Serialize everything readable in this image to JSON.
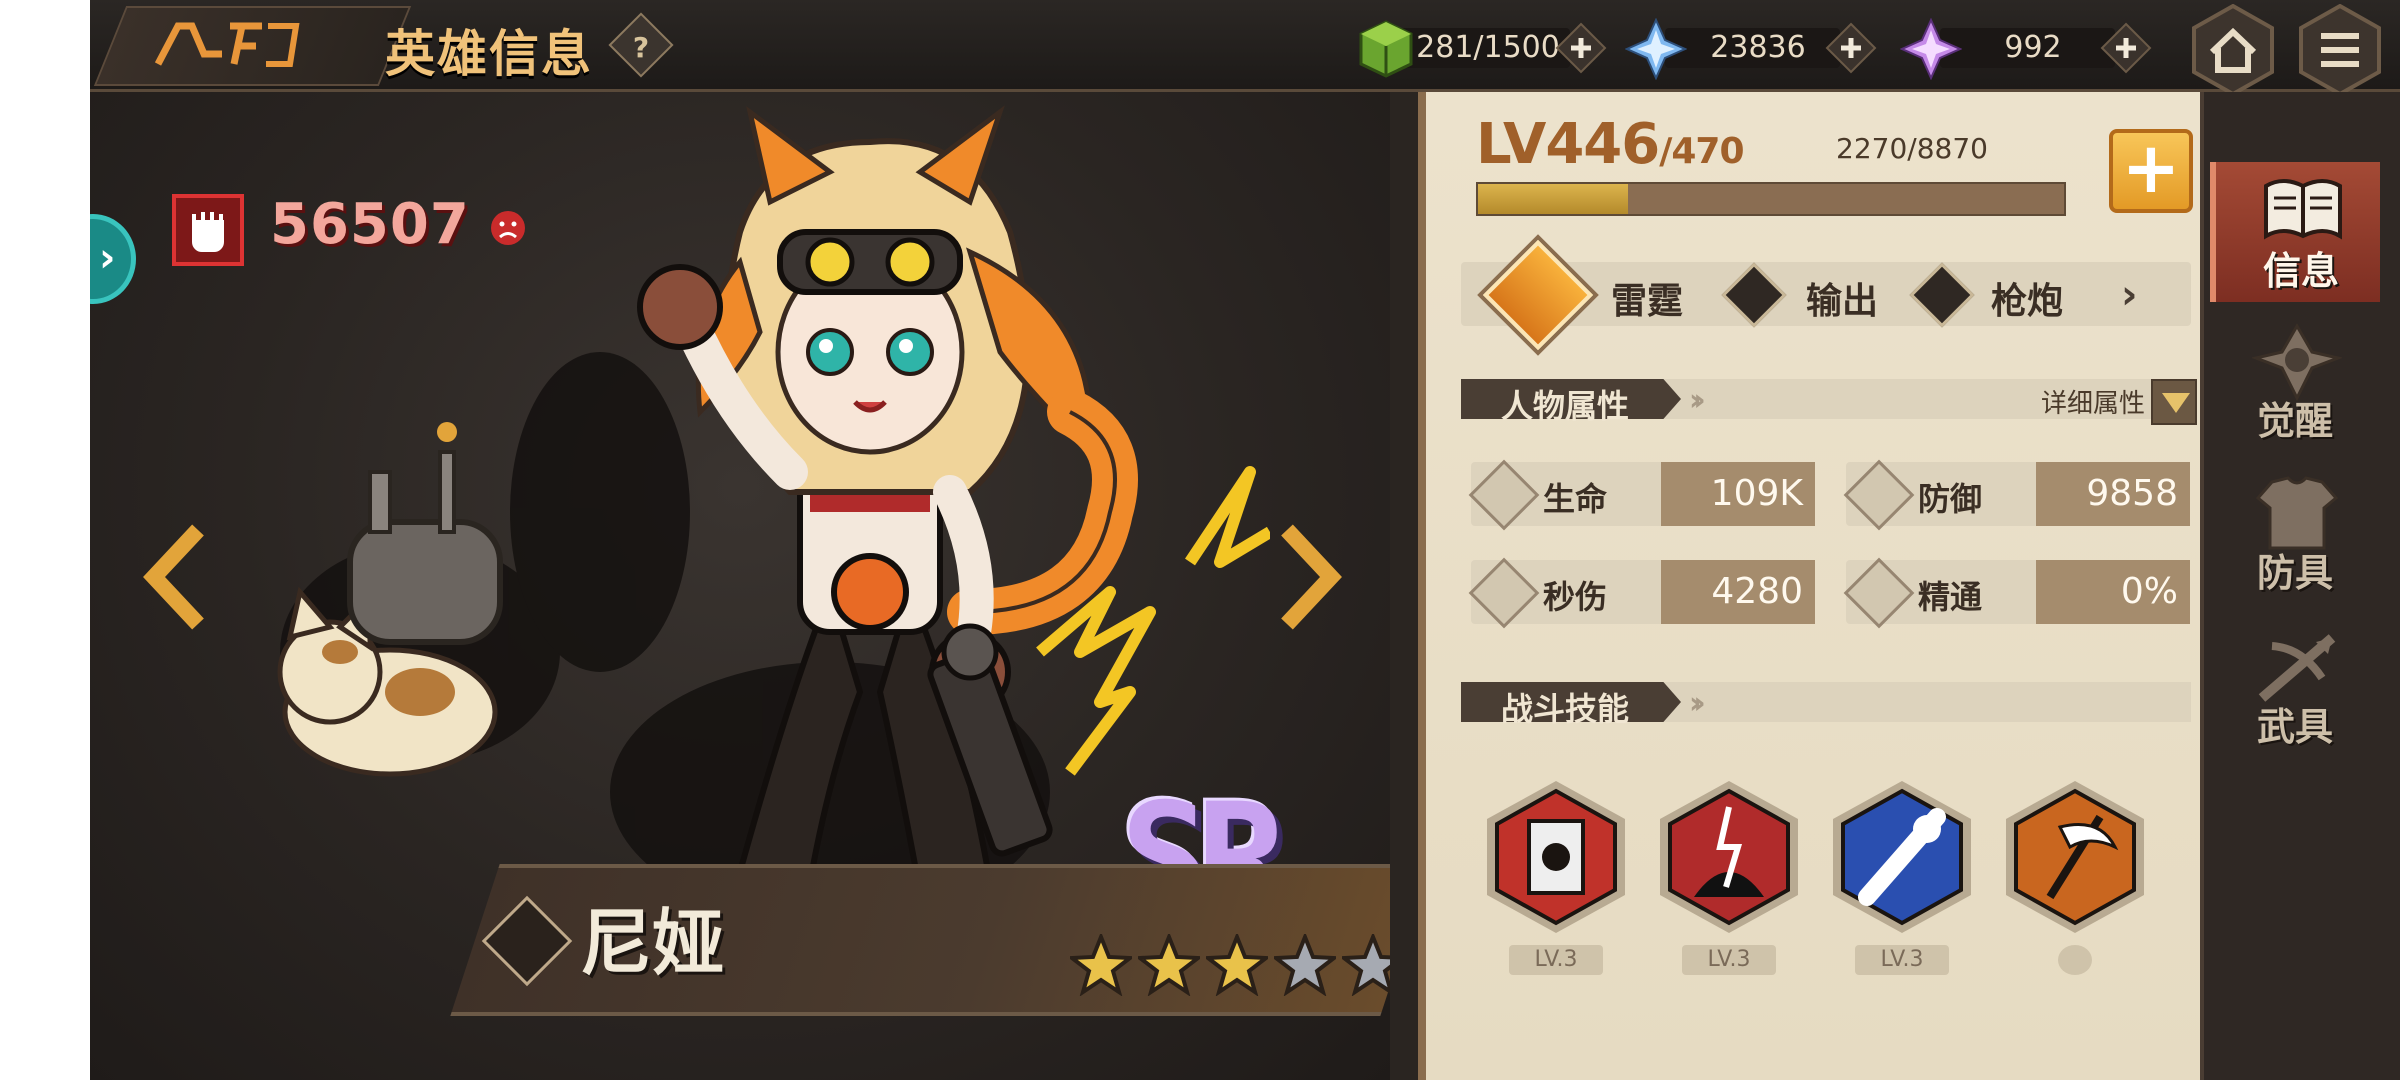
{
  "header": {
    "title": "英雄信息",
    "help_glyph": "?"
  },
  "resources": [
    {
      "name": "stamina",
      "value": "281/1500",
      "icon": "green-cube-icon"
    },
    {
      "name": "crystal",
      "value": "23836",
      "icon": "blue-crystal-icon"
    },
    {
      "name": "gem",
      "value": "992",
      "icon": "pink-crystal-icon"
    }
  ],
  "hero": {
    "power": "56507",
    "name": "尼娅",
    "rarity": "SR",
    "stars_filled": 3,
    "stars_total": 5
  },
  "level": {
    "current": "LV446",
    "max": "/470",
    "exp_text": "2270/8870",
    "exp_fraction": 0.256
  },
  "tags": {
    "element": "雷霆",
    "role": "输出",
    "weapon": "枪炮"
  },
  "attributes": {
    "section_title": "人物属性",
    "detail_label": "详细属性",
    "items": [
      {
        "label": "生命",
        "value": "109K",
        "icon": "heart-icon"
      },
      {
        "label": "防御",
        "value": "9858",
        "icon": "shield-icon"
      },
      {
        "label": "秒伤",
        "value": "4280",
        "icon": "dps-icon"
      },
      {
        "label": "精通",
        "value": "0%",
        "icon": "mastery-icon"
      }
    ]
  },
  "skills": {
    "section_title": "战斗技能",
    "items": [
      {
        "level": "LV.3",
        "icon": "camera-skill-icon"
      },
      {
        "level": "LV.3",
        "icon": "lightning-cat-skill-icon"
      },
      {
        "level": "LV.3",
        "icon": "paw-strike-skill-icon"
      },
      {
        "level": "",
        "icon": "scythe-skill-icon"
      }
    ]
  },
  "side_nav": [
    {
      "label": "信息",
      "icon": "book-icon",
      "active": true
    },
    {
      "label": "觉醒",
      "icon": "crest-icon",
      "active": false
    },
    {
      "label": "防具",
      "icon": "armor-icon",
      "active": false
    },
    {
      "label": "武具",
      "icon": "crossbow-icon",
      "active": false
    }
  ],
  "colors": {
    "accent_gold": "#f0c27a",
    "power_red": "#f3a79c",
    "rarity_purple": "#c8a2f0",
    "panel_paper": "#ece2cc"
  }
}
